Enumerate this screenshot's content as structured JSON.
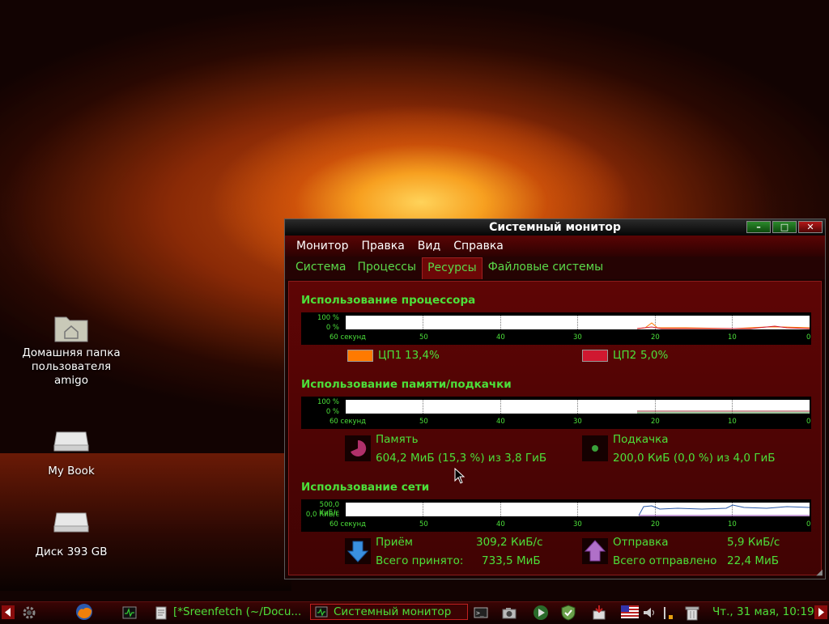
{
  "desktop": {
    "icons": [
      {
        "label": "Домашняя папка пользователя amigo"
      },
      {
        "label": "My Book"
      },
      {
        "label": "Диск 393 GB"
      }
    ]
  },
  "window": {
    "title": "Системный монитор",
    "buttons": {
      "minimize": "–",
      "maximize": "□",
      "close": "✕"
    },
    "menu": [
      "Монитор",
      "Правка",
      "Вид",
      "Справка"
    ],
    "tabs": [
      "Система",
      "Процессы",
      "Ресурсы",
      "Файловые системы"
    ],
    "active_tab": "Ресурсы"
  },
  "cpu": {
    "title": "Использование процессора",
    "y_top": "100 %",
    "y_bottom": "0 %",
    "x_labels": [
      "60 секунд",
      "50",
      "40",
      "30",
      "20",
      "10",
      "0"
    ],
    "cpu1_label": "ЦП1",
    "cpu1_value": "13,4%",
    "cpu1_color": "#ff7a00",
    "cpu2_label": "ЦП2",
    "cpu2_value": "5,0%",
    "cpu2_color": "#d01830"
  },
  "memory": {
    "title": "Использование памяти/подкачки",
    "y_top": "100 %",
    "y_bottom": "0 %",
    "x_labels": [
      "60 секунд",
      "50",
      "40",
      "30",
      "20",
      "10",
      "0"
    ],
    "mem_label": "Память",
    "mem_value": "604,2 МиБ (15,3 %) из 3,8 ГиБ",
    "swap_label": "Подкачка",
    "swap_value": "200,0 КиБ (0,0 %) из 4,0 ГиБ"
  },
  "network": {
    "title": "Использование сети",
    "y_top": "500,0 КиБ/с",
    "y_bottom": "0,0 КиБ/с",
    "x_labels": [
      "60 секунд",
      "50",
      "40",
      "30",
      "20",
      "10",
      "0"
    ],
    "recv_label": "Приём",
    "recv_value": "309,2 КиБ/с",
    "recv_total_label": "Всего принято:",
    "recv_total_value": "733,5 МиБ",
    "send_label": "Отправка",
    "send_value": "5,9 КиБ/с",
    "send_total_label": "Всего отправлено",
    "send_total_value": "22,4 МиБ"
  },
  "taskbar": {
    "task1": "[*Sreenfetch (~/Docu...",
    "task2": "Системный монитор",
    "clock": "Чт., 31 мая, 10:19"
  }
}
